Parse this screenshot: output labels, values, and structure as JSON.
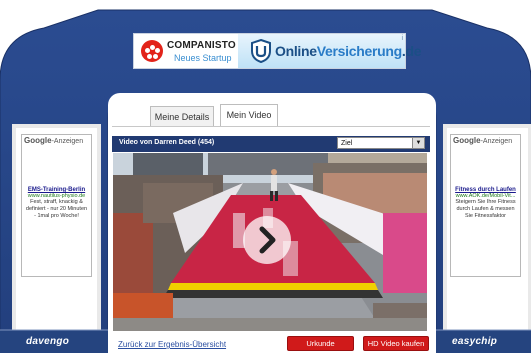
{
  "banner": {
    "brand": "COMPANISTO",
    "tagline": "Neues Startup",
    "ov_part1": "Online",
    "ov_part2": "Versicherung",
    "ov_part3": ".de",
    "ad_mark": "i"
  },
  "ads": {
    "left": {
      "google": "Google",
      "anzeigen": "-Anzeigen",
      "title": "EMS-Training-Berlin",
      "url": "www.nautilus-physio.de",
      "desc": "Fest, straff, knackig & definiert - nur 20 Minuten - 1mal pro Woche!"
    },
    "right": {
      "google": "Google",
      "anzeigen": "-Anzeigen",
      "title": "Fitness durch Laufen",
      "url": "www.AOK.de/Mobil-Vit...",
      "desc": "Steigern Sie Ihre Fitness durch Laufen & messen Sie Fitnessfaktor"
    }
  },
  "tabs": [
    {
      "label": "Meine Details"
    },
    {
      "label": "Mein Video"
    }
  ],
  "video": {
    "title": "Video von Darren Deed (454)",
    "select_value": "Ziel"
  },
  "footer": {
    "back_link": "Zurück zur Ergebnis-Übersicht",
    "certificate_button": "Urkunde",
    "hd_button": "HD Video kaufen",
    "left_brand": "davengo",
    "right_brand": "easychip"
  },
  "colors": {
    "arch": "#27478a",
    "bar": "#213a72",
    "button": "#d01a1a"
  }
}
